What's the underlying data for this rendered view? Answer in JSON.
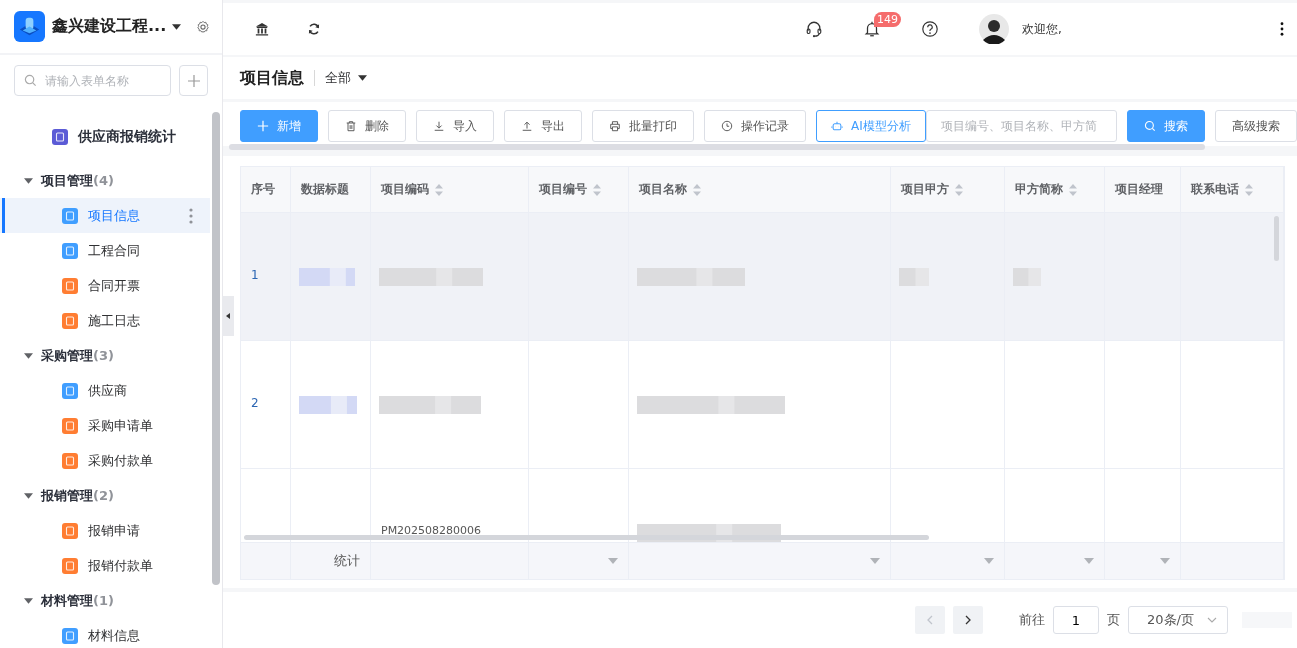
{
  "app": {
    "title": "鑫兴建设工程..."
  },
  "sidebar": {
    "search": {
      "placeholder": "请输入表单名称"
    },
    "tree": [
      {
        "kind": "form",
        "label": "供应商报销统计",
        "color": "#5b5bd6",
        "selected": false
      },
      {
        "kind": "group",
        "label": "项目管理",
        "count": "(4)",
        "expanded": true,
        "children": [
          {
            "label": "项目信息",
            "color": "#409eff",
            "selected": true
          },
          {
            "label": "工程合同",
            "color": "#409eff",
            "selected": false
          },
          {
            "label": "合同开票",
            "color": "#ff7d32",
            "selected": false
          },
          {
            "label": "施工日志",
            "color": "#ff7d32",
            "selected": false
          }
        ]
      },
      {
        "kind": "group",
        "label": "采购管理",
        "count": "(3)",
        "expanded": true,
        "children": [
          {
            "label": "供应商",
            "color": "#409eff",
            "selected": false
          },
          {
            "label": "采购申请单",
            "color": "#ff7d32",
            "selected": false
          },
          {
            "label": "采购付款单",
            "color": "#ff7d32",
            "selected": false
          }
        ]
      },
      {
        "kind": "group",
        "label": "报销管理",
        "count": "(2)",
        "expanded": true,
        "children": [
          {
            "label": "报销申请",
            "color": "#ff7d32",
            "selected": false
          },
          {
            "label": "报销付款单",
            "color": "#ff7d32",
            "selected": false
          }
        ]
      },
      {
        "kind": "group",
        "label": "材料管理",
        "count": "(1)",
        "expanded": true,
        "children": [
          {
            "label": "材料信息",
            "color": "#409eff",
            "selected": false
          }
        ]
      }
    ]
  },
  "header": {
    "notification_badge": "149",
    "greeting": "欢迎您,"
  },
  "page": {
    "title": "项目信息",
    "filter": "全部"
  },
  "toolbar": {
    "buttons": [
      {
        "label": "新增",
        "kind": "primary"
      },
      {
        "label": "删除",
        "kind": "plain"
      },
      {
        "label": "导入",
        "kind": "plain"
      },
      {
        "label": "导出",
        "kind": "plain"
      },
      {
        "label": "批量打印",
        "kind": "plain"
      },
      {
        "label": "操作记录",
        "kind": "plain"
      },
      {
        "label": "AI模型分析",
        "kind": "outline"
      }
    ],
    "search": {
      "placeholder": "项目编号、项目名称、甲方简"
    },
    "search_button": "搜索",
    "advanced_button": "高级搜索"
  },
  "table": {
    "columns": [
      {
        "label": "序号",
        "sortable": false,
        "total_menu": false
      },
      {
        "label": "数据标题",
        "sortable": false,
        "total_menu": false
      },
      {
        "label": "项目编码",
        "sortable": true,
        "total_menu": false
      },
      {
        "label": "项目编号",
        "sortable": true,
        "total_menu": true
      },
      {
        "label": "项目名称",
        "sortable": true,
        "total_menu": true
      },
      {
        "label": "项目甲方",
        "sortable": true,
        "total_menu": true
      },
      {
        "label": "甲方简称",
        "sortable": true,
        "total_menu": true
      },
      {
        "label": "项目经理",
        "sortable": false,
        "total_menu": true
      },
      {
        "label": "联系电话",
        "sortable": true,
        "total_menu": false
      }
    ],
    "rows": [
      {
        "index": "1",
        "selected": true
      },
      {
        "index": "2",
        "selected": false
      },
      {
        "code": "PM202508280006",
        "selected": false
      }
    ],
    "summary_label": "统计"
  },
  "pagination": {
    "prev_disabled": true,
    "goto_label": "前往",
    "page": "1",
    "page_suffix": "页",
    "page_size": "20条/页"
  }
}
